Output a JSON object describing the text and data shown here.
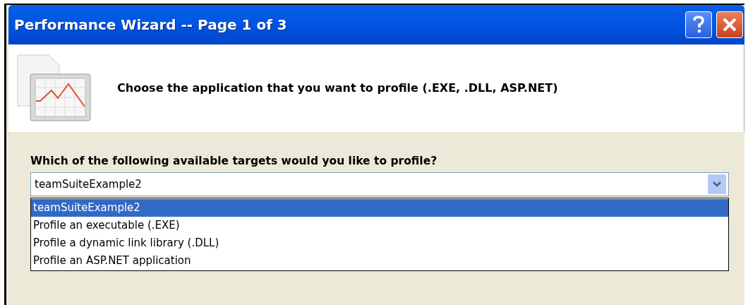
{
  "window": {
    "title": "Performance Wizard -- Page 1 of 3"
  },
  "header": {
    "text": "Choose the application that you want to profile (.EXE, .DLL, ASP.NET)"
  },
  "question": "Which of the following available targets would you like to profile?",
  "combo": {
    "value": "teamSuiteExample2",
    "expanded": true
  },
  "options": [
    {
      "label": "teamSuiteExample2",
      "selected": true
    },
    {
      "label": "Profile an executable (.EXE)",
      "selected": false
    },
    {
      "label": "Profile a dynamic link library (.DLL)",
      "selected": false
    },
    {
      "label": "Profile an ASP.NET application",
      "selected": false
    }
  ]
}
